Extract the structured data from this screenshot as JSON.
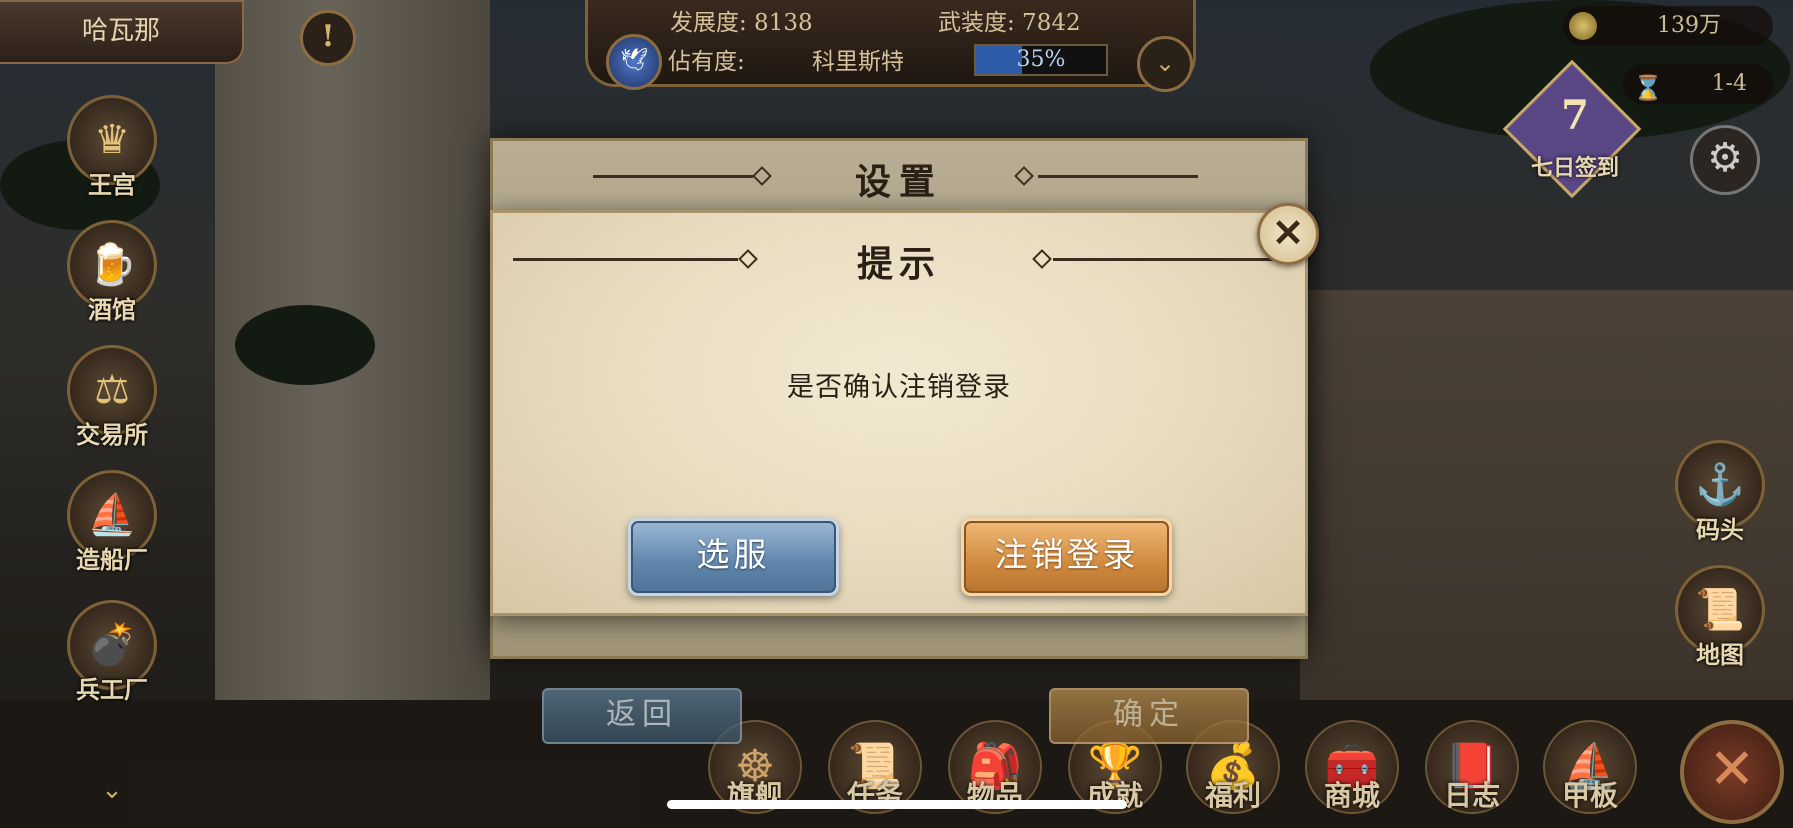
{
  "top_bar": {
    "city_name": "哈瓦那",
    "development": "发展度: 8138",
    "armament": "武装度: 7842",
    "occupancy_label": "佔有度:",
    "occupancy_city": "科里斯特",
    "occupancy_percent": 35,
    "occupancy_text": "35%"
  },
  "resources": {
    "gold": "139万",
    "time": "1-4"
  },
  "sign_in": {
    "number": "7",
    "label": "七日签到"
  },
  "left_menu": [
    {
      "label": "王宫",
      "icon": "crown-icon"
    },
    {
      "label": "酒馆",
      "icon": "beer-mug-icon"
    },
    {
      "label": "交易所",
      "icon": "scales-icon"
    },
    {
      "label": "造船厂",
      "icon": "ship-icon"
    },
    {
      "label": "兵工厂",
      "icon": "cannon-icon"
    }
  ],
  "right_menu": [
    {
      "label": "码头",
      "icon": "dock-icon"
    },
    {
      "label": "地图",
      "icon": "scroll-map-icon"
    }
  ],
  "bottom_nav": [
    {
      "label": "旗舰",
      "icon": "ship-wheel-icon"
    },
    {
      "label": "任务",
      "icon": "quest-scroll-icon"
    },
    {
      "label": "物品",
      "icon": "bag-icon"
    },
    {
      "label": "成就",
      "icon": "trophy-icon"
    },
    {
      "label": "福利",
      "icon": "coins-icon"
    },
    {
      "label": "商城",
      "icon": "treasure-chest-icon"
    },
    {
      "label": "日志",
      "icon": "book-icon"
    },
    {
      "label": "甲板",
      "icon": "sailing-ship-icon"
    }
  ],
  "settings_dialog": {
    "title": "设置",
    "back_label": "返回",
    "confirm_label": "确定"
  },
  "confirm_dialog": {
    "title": "提示",
    "message": "是否确认注销登录",
    "server_button": "选服",
    "logout_button": "注销登录"
  },
  "colors": {
    "blue_button": "#6f93b8",
    "orange_button": "#d08a3e",
    "parchment": "#eadfc5"
  }
}
